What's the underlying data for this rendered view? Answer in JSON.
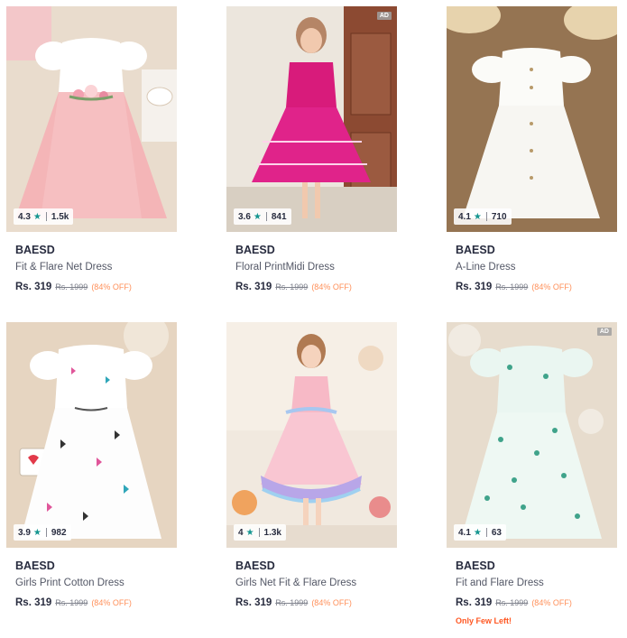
{
  "products": [
    {
      "brand": "BAESD",
      "name": "Fit & Flare Net Dress",
      "rating": "4.3",
      "count": "1.5k",
      "price": "Rs. 319",
      "mrp": "Rs. 1999",
      "discount": "(84% OFF)",
      "ad": "",
      "stock": ""
    },
    {
      "brand": "BAESD",
      "name": "Floral PrintMidi Dress",
      "rating": "3.6",
      "count": "841",
      "price": "Rs. 319",
      "mrp": "Rs. 1999",
      "discount": "(84% OFF)",
      "ad": "AD",
      "stock": ""
    },
    {
      "brand": "BAESD",
      "name": "A-Line Dress",
      "rating": "4.1",
      "count": "710",
      "price": "Rs. 319",
      "mrp": "Rs. 1999",
      "discount": "(84% OFF)",
      "ad": "",
      "stock": ""
    },
    {
      "brand": "BAESD",
      "name": "Girls Print Cotton Dress",
      "rating": "3.9",
      "count": "982",
      "price": "Rs. 319",
      "mrp": "Rs. 1999",
      "discount": "(84% OFF)",
      "ad": "",
      "stock": ""
    },
    {
      "brand": "BAESD",
      "name": "Girls Net Fit & Flare Dress",
      "rating": "4",
      "count": "1.3k",
      "price": "Rs. 319",
      "mrp": "Rs. 1999",
      "discount": "(84% OFF)",
      "ad": "",
      "stock": ""
    },
    {
      "brand": "BAESD",
      "name": "Fit and Flare Dress",
      "rating": "4.1",
      "count": "63",
      "price": "Rs. 319",
      "mrp": "Rs. 1999",
      "discount": "(84% OFF)",
      "ad": "AD",
      "stock": "Only Few Left!"
    }
  ],
  "icons": {
    "rating_star": "star-icon"
  },
  "colors": {
    "rating_star": "#14958f",
    "discount": "#ff905a",
    "stock_warning": "#ff5722"
  }
}
